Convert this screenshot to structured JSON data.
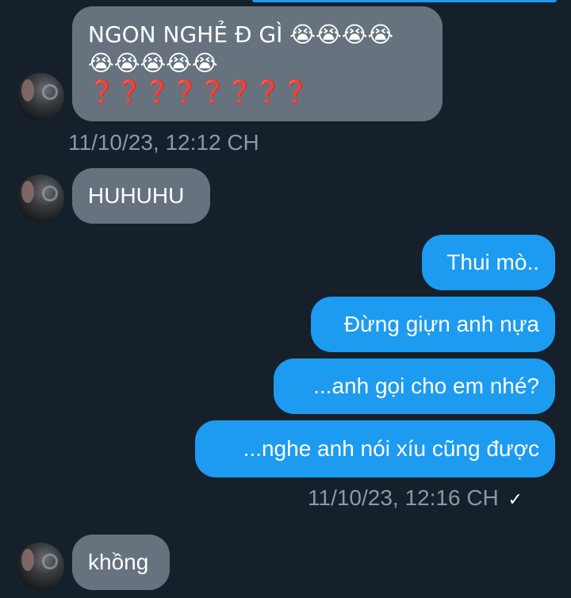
{
  "messages": {
    "m1": {
      "line1_text": "NGON NGHẺ Đ GÌ",
      "line1_emoji": "😭😭😭😭",
      "line2_emoji": "😭😭😭😭😭",
      "line3": "❓❓❓❓❓❓❓❓"
    },
    "ts1": "11/10/23, 12:12 CH",
    "m2": "HUHUHU",
    "m3": "Thui mò..",
    "m4": "Đừng giựn anh nựa",
    "m5": "...anh gọi cho em nhé?",
    "m6": "...nghe anh nói xíu cũng được",
    "ts2": "11/10/23, 12:16 CH",
    "ts2_check": "✓",
    "m7": "khồng"
  },
  "colors": {
    "background": "#15202b",
    "incoming_bubble": "#66737f",
    "outgoing_bubble": "#1d9bf0",
    "timestamp": "#8b98a5"
  }
}
